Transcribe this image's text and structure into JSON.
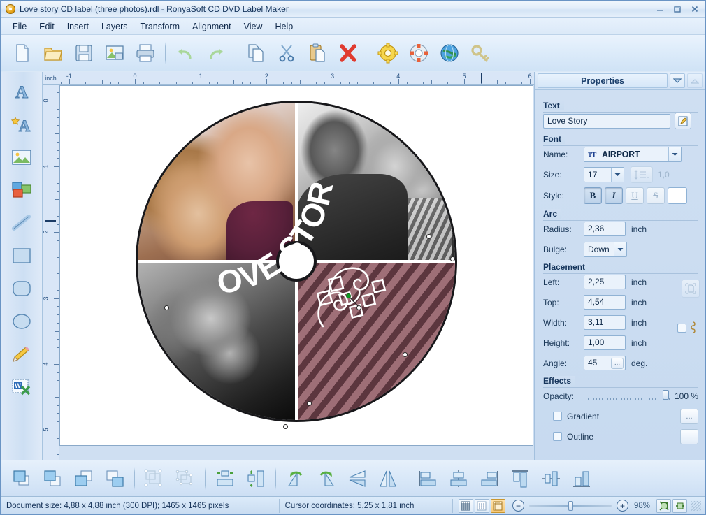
{
  "window": {
    "title": "Love story CD label (three photos).rdl - RonyaSoft CD DVD Label Maker",
    "app_icon": "cd-disc-icon",
    "minimize_label": "Minimize",
    "restore_label": "Restore",
    "close_label": "Close"
  },
  "menu": {
    "items": [
      {
        "label": "File"
      },
      {
        "label": "Edit"
      },
      {
        "label": "Insert"
      },
      {
        "label": "Layers"
      },
      {
        "label": "Transform"
      },
      {
        "label": "Alignment"
      },
      {
        "label": "View"
      },
      {
        "label": "Help"
      }
    ]
  },
  "toolbar": {
    "buttons": [
      {
        "name": "new-document-icon",
        "tip": "New"
      },
      {
        "name": "open-folder-icon",
        "tip": "Open"
      },
      {
        "name": "save-floppy-icon",
        "tip": "Save"
      },
      {
        "name": "save-image-icon",
        "tip": "Save as image"
      },
      {
        "name": "print-icon",
        "tip": "Print"
      },
      {
        "name": "undo-arrow-icon",
        "tip": "Undo"
      },
      {
        "name": "redo-arrow-icon",
        "tip": "Redo"
      },
      {
        "name": "copy-icon",
        "tip": "Copy"
      },
      {
        "name": "cut-scissors-icon",
        "tip": "Cut"
      },
      {
        "name": "paste-clipboard-icon",
        "tip": "Paste"
      },
      {
        "name": "delete-cross-icon",
        "tip": "Delete"
      },
      {
        "name": "settings-gear-icon",
        "tip": "Options"
      },
      {
        "name": "help-lifebuoy-icon",
        "tip": "Help"
      },
      {
        "name": "globe-icon",
        "tip": "Web site"
      },
      {
        "name": "key-icon",
        "tip": "Registration"
      }
    ]
  },
  "palette": {
    "tools": [
      {
        "name": "text-tool-icon",
        "tip": "Text"
      },
      {
        "name": "art-text-tool-icon",
        "tip": "Art text"
      },
      {
        "name": "image-tool-icon",
        "tip": "Image"
      },
      {
        "name": "shapes-tool-icon",
        "tip": "Clipart"
      },
      {
        "name": "line-tool-icon",
        "tip": "Line"
      },
      {
        "name": "rectangle-tool-icon",
        "tip": "Rectangle"
      },
      {
        "name": "rounded-rect-tool-icon",
        "tip": "Rounded rectangle"
      },
      {
        "name": "ellipse-tool-icon",
        "tip": "Ellipse"
      },
      {
        "name": "pencil-tool-icon",
        "tip": "Pencil"
      },
      {
        "name": "mail-merge-tool-icon",
        "tip": "Mail merge"
      }
    ]
  },
  "ruler": {
    "unit_label": "inch",
    "h_labels": [
      "-1",
      "0",
      "1",
      "2",
      "3",
      "4",
      "5",
      "6"
    ],
    "v_labels": [
      "0",
      "1",
      "2",
      "3",
      "4",
      "5"
    ],
    "cursor_x_inch": 5.25,
    "cursor_y_inch": 1.81
  },
  "canvas": {
    "label_text": "LOVE STORY",
    "ornament": "flourish-ornament",
    "quadrants": [
      {
        "name": "photo-top-left",
        "kind": "color-photo"
      },
      {
        "name": "photo-top-right",
        "kind": "bw-photo"
      },
      {
        "name": "photo-bottom-left",
        "kind": "bw-photo"
      },
      {
        "name": "striped-panel-bottom-right",
        "kind": "striped-text-panel"
      }
    ],
    "stripe_color": "#8a6069",
    "text_color": "#ffffff"
  },
  "properties": {
    "panel_title": "Properties",
    "collapse_icon": "chevron-down-icon",
    "expand_icon": "chevron-up-icon",
    "text": {
      "group": "Text",
      "value": "Love Story",
      "edit_icon": "edit-text-icon"
    },
    "font": {
      "group": "Font",
      "name_label": "Name:",
      "name_value": "AIRPORT",
      "name_prefix_icon": "truetype-icon",
      "size_label": "Size:",
      "size_value": "17",
      "line_spacing_icon": "line-spacing-icon",
      "line_spacing_value": "1,0",
      "style_label": "Style:",
      "bold_label": "B",
      "italic_label": "I",
      "underline_label": "U",
      "strike_label": "S",
      "bold_active": true,
      "italic_active": true,
      "underline_active": false,
      "strike_active": false,
      "color_swatch": "#ffffff"
    },
    "arc": {
      "group": "Arc",
      "radius_label": "Radius:",
      "radius_value": "2,36",
      "radius_unit": "inch",
      "bulge_label": "Bulge:",
      "bulge_value": "Down"
    },
    "placement": {
      "group": "Placement",
      "left_label": "Left:",
      "left_value": "2,25",
      "top_label": "Top:",
      "top_value": "4,54",
      "width_label": "Width:",
      "width_value": "3,11",
      "height_label": "Height:",
      "height_value": "1,00",
      "angle_label": "Angle:",
      "angle_value": "45",
      "angle_unit": "deg.",
      "unit": "inch",
      "fit_icon": "fit-to-selection-icon",
      "lock_ratio_icon": "link-ratio-icon",
      "angle_picker_label": "..."
    },
    "effects": {
      "group": "Effects",
      "opacity_label": "Opacity:",
      "opacity_value": "100 %",
      "gradient_label": "Gradient",
      "gradient_checked": false,
      "gradient_more": "...",
      "outline_label": "Outline",
      "outline_checked": false
    }
  },
  "bottom_toolbar": {
    "buttons": [
      {
        "name": "bring-to-front-icon",
        "tip": "Bring to front"
      },
      {
        "name": "bring-forward-icon",
        "tip": "Bring forward"
      },
      {
        "name": "send-backward-icon",
        "tip": "Send backward"
      },
      {
        "name": "send-to-back-icon",
        "tip": "Send to back"
      },
      {
        "name": "group-objects-icon",
        "tip": "Group"
      },
      {
        "name": "ungroup-objects-icon",
        "tip": "Ungroup"
      },
      {
        "name": "center-horizontally-icon",
        "tip": "Center horizontally"
      },
      {
        "name": "center-vertically-icon",
        "tip": "Center vertically"
      },
      {
        "name": "rotate-left-icon",
        "tip": "Rotate left"
      },
      {
        "name": "rotate-right-icon",
        "tip": "Rotate right"
      },
      {
        "name": "flip-vertical-icon",
        "tip": "Flip vertical"
      },
      {
        "name": "flip-horizontal-icon",
        "tip": "Flip horizontal"
      },
      {
        "name": "align-left-icon",
        "tip": "Align left"
      },
      {
        "name": "align-center-icon",
        "tip": "Align center"
      },
      {
        "name": "align-right-icon",
        "tip": "Align right"
      },
      {
        "name": "align-top-icon",
        "tip": "Align top"
      },
      {
        "name": "align-middle-icon",
        "tip": "Align middle"
      },
      {
        "name": "align-bottom-icon",
        "tip": "Align bottom"
      }
    ]
  },
  "statusbar": {
    "document_size": "Document size: 4,88 x 4,88 inch (300 DPI); 1465 x 1465 pixels",
    "cursor_coordinates": "Cursor coordinates: 5,25 x 1,81 inch",
    "zoom_percent": "98%",
    "zoom_out_label": "−",
    "zoom_in_label": "+",
    "view_buttons": [
      {
        "name": "grid-view-icon",
        "selected": false
      },
      {
        "name": "dot-grid-icon",
        "selected": false
      },
      {
        "name": "rulers-toggle-icon",
        "selected": true
      }
    ],
    "fit_buttons": [
      {
        "name": "fit-page-icon"
      },
      {
        "name": "fit-width-icon"
      }
    ]
  }
}
